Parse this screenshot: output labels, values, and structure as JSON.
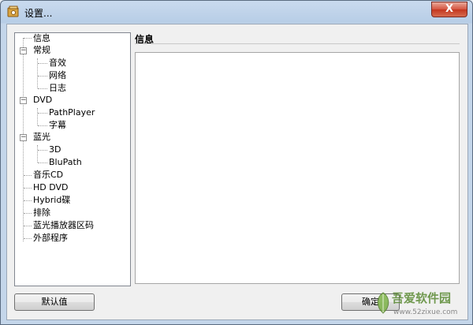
{
  "window": {
    "title": "设置...",
    "close_label": "X"
  },
  "tree": {
    "items": [
      {
        "label": "信息"
      },
      {
        "label": "常规",
        "expander": "−"
      },
      {
        "label": "音效"
      },
      {
        "label": "网络"
      },
      {
        "label": "日志"
      },
      {
        "label": "DVD",
        "expander": "−"
      },
      {
        "label": "PathPlayer"
      },
      {
        "label": "字幕"
      },
      {
        "label": "蓝光",
        "expander": "−"
      },
      {
        "label": "3D"
      },
      {
        "label": "BluPath"
      },
      {
        "label": "音乐CD"
      },
      {
        "label": "HD DVD"
      },
      {
        "label": "Hybrid碟"
      },
      {
        "label": "排除"
      },
      {
        "label": "蓝光播放器区码"
      },
      {
        "label": "外部程序"
      }
    ]
  },
  "panel": {
    "title": "信息"
  },
  "buttons": {
    "default_label": "默认值",
    "ok_label": "确定"
  },
  "watermark": {
    "name": "吾爱软件园",
    "url": "www.52zixue.com"
  }
}
